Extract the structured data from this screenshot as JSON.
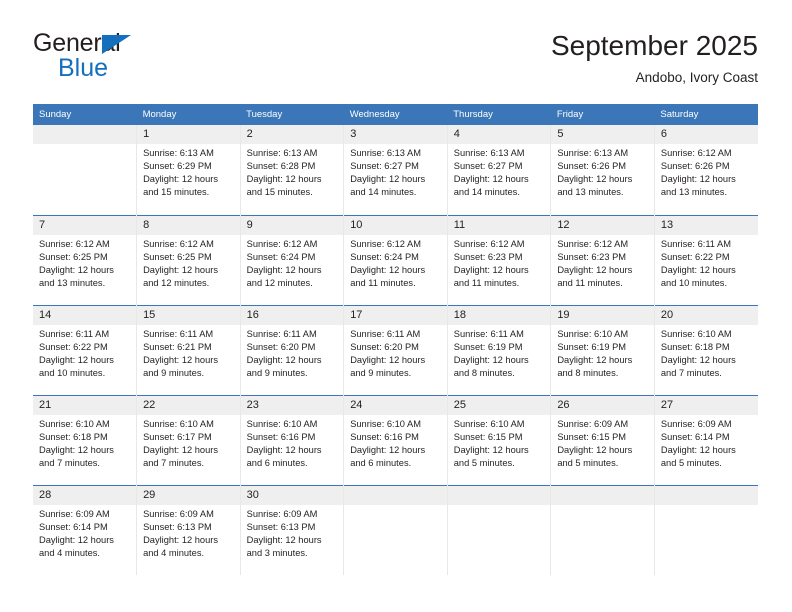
{
  "brand": {
    "name_top": "General",
    "name_bottom": "Blue",
    "accent_color": "#1470bd",
    "triangle_icon": "triangle-right-icon"
  },
  "header": {
    "title": "September 2025",
    "subtitle": "Andobo, Ivory Coast"
  },
  "theme": {
    "header_row_bg": "#3a76b8",
    "daynum_bg": "#efefef",
    "text_color": "#231f20"
  },
  "calendar": {
    "weekday_headers": [
      "Sunday",
      "Monday",
      "Tuesday",
      "Wednesday",
      "Thursday",
      "Friday",
      "Saturday"
    ],
    "weeks": [
      [
        {
          "day": ""
        },
        {
          "day": "1",
          "sunrise": "Sunrise: 6:13 AM",
          "sunset": "Sunset: 6:29 PM",
          "daylight": "Daylight: 12 hours and 15 minutes."
        },
        {
          "day": "2",
          "sunrise": "Sunrise: 6:13 AM",
          "sunset": "Sunset: 6:28 PM",
          "daylight": "Daylight: 12 hours and 15 minutes."
        },
        {
          "day": "3",
          "sunrise": "Sunrise: 6:13 AM",
          "sunset": "Sunset: 6:27 PM",
          "daylight": "Daylight: 12 hours and 14 minutes."
        },
        {
          "day": "4",
          "sunrise": "Sunrise: 6:13 AM",
          "sunset": "Sunset: 6:27 PM",
          "daylight": "Daylight: 12 hours and 14 minutes."
        },
        {
          "day": "5",
          "sunrise": "Sunrise: 6:13 AM",
          "sunset": "Sunset: 6:26 PM",
          "daylight": "Daylight: 12 hours and 13 minutes."
        },
        {
          "day": "6",
          "sunrise": "Sunrise: 6:12 AM",
          "sunset": "Sunset: 6:26 PM",
          "daylight": "Daylight: 12 hours and 13 minutes."
        }
      ],
      [
        {
          "day": "7",
          "sunrise": "Sunrise: 6:12 AM",
          "sunset": "Sunset: 6:25 PM",
          "daylight": "Daylight: 12 hours and 13 minutes."
        },
        {
          "day": "8",
          "sunrise": "Sunrise: 6:12 AM",
          "sunset": "Sunset: 6:25 PM",
          "daylight": "Daylight: 12 hours and 12 minutes."
        },
        {
          "day": "9",
          "sunrise": "Sunrise: 6:12 AM",
          "sunset": "Sunset: 6:24 PM",
          "daylight": "Daylight: 12 hours and 12 minutes."
        },
        {
          "day": "10",
          "sunrise": "Sunrise: 6:12 AM",
          "sunset": "Sunset: 6:24 PM",
          "daylight": "Daylight: 12 hours and 11 minutes."
        },
        {
          "day": "11",
          "sunrise": "Sunrise: 6:12 AM",
          "sunset": "Sunset: 6:23 PM",
          "daylight": "Daylight: 12 hours and 11 minutes."
        },
        {
          "day": "12",
          "sunrise": "Sunrise: 6:12 AM",
          "sunset": "Sunset: 6:23 PM",
          "daylight": "Daylight: 12 hours and 11 minutes."
        },
        {
          "day": "13",
          "sunrise": "Sunrise: 6:11 AM",
          "sunset": "Sunset: 6:22 PM",
          "daylight": "Daylight: 12 hours and 10 minutes."
        }
      ],
      [
        {
          "day": "14",
          "sunrise": "Sunrise: 6:11 AM",
          "sunset": "Sunset: 6:22 PM",
          "daylight": "Daylight: 12 hours and 10 minutes."
        },
        {
          "day": "15",
          "sunrise": "Sunrise: 6:11 AM",
          "sunset": "Sunset: 6:21 PM",
          "daylight": "Daylight: 12 hours and 9 minutes."
        },
        {
          "day": "16",
          "sunrise": "Sunrise: 6:11 AM",
          "sunset": "Sunset: 6:20 PM",
          "daylight": "Daylight: 12 hours and 9 minutes."
        },
        {
          "day": "17",
          "sunrise": "Sunrise: 6:11 AM",
          "sunset": "Sunset: 6:20 PM",
          "daylight": "Daylight: 12 hours and 9 minutes."
        },
        {
          "day": "18",
          "sunrise": "Sunrise: 6:11 AM",
          "sunset": "Sunset: 6:19 PM",
          "daylight": "Daylight: 12 hours and 8 minutes."
        },
        {
          "day": "19",
          "sunrise": "Sunrise: 6:10 AM",
          "sunset": "Sunset: 6:19 PM",
          "daylight": "Daylight: 12 hours and 8 minutes."
        },
        {
          "day": "20",
          "sunrise": "Sunrise: 6:10 AM",
          "sunset": "Sunset: 6:18 PM",
          "daylight": "Daylight: 12 hours and 7 minutes."
        }
      ],
      [
        {
          "day": "21",
          "sunrise": "Sunrise: 6:10 AM",
          "sunset": "Sunset: 6:18 PM",
          "daylight": "Daylight: 12 hours and 7 minutes."
        },
        {
          "day": "22",
          "sunrise": "Sunrise: 6:10 AM",
          "sunset": "Sunset: 6:17 PM",
          "daylight": "Daylight: 12 hours and 7 minutes."
        },
        {
          "day": "23",
          "sunrise": "Sunrise: 6:10 AM",
          "sunset": "Sunset: 6:16 PM",
          "daylight": "Daylight: 12 hours and 6 minutes."
        },
        {
          "day": "24",
          "sunrise": "Sunrise: 6:10 AM",
          "sunset": "Sunset: 6:16 PM",
          "daylight": "Daylight: 12 hours and 6 minutes."
        },
        {
          "day": "25",
          "sunrise": "Sunrise: 6:10 AM",
          "sunset": "Sunset: 6:15 PM",
          "daylight": "Daylight: 12 hours and 5 minutes."
        },
        {
          "day": "26",
          "sunrise": "Sunrise: 6:09 AM",
          "sunset": "Sunset: 6:15 PM",
          "daylight": "Daylight: 12 hours and 5 minutes."
        },
        {
          "day": "27",
          "sunrise": "Sunrise: 6:09 AM",
          "sunset": "Sunset: 6:14 PM",
          "daylight": "Daylight: 12 hours and 5 minutes."
        }
      ],
      [
        {
          "day": "28",
          "sunrise": "Sunrise: 6:09 AM",
          "sunset": "Sunset: 6:14 PM",
          "daylight": "Daylight: 12 hours and 4 minutes."
        },
        {
          "day": "29",
          "sunrise": "Sunrise: 6:09 AM",
          "sunset": "Sunset: 6:13 PM",
          "daylight": "Daylight: 12 hours and 4 minutes."
        },
        {
          "day": "30",
          "sunrise": "Sunrise: 6:09 AM",
          "sunset": "Sunset: 6:13 PM",
          "daylight": "Daylight: 12 hours and 3 minutes."
        },
        {
          "day": ""
        },
        {
          "day": ""
        },
        {
          "day": ""
        },
        {
          "day": ""
        }
      ]
    ]
  }
}
